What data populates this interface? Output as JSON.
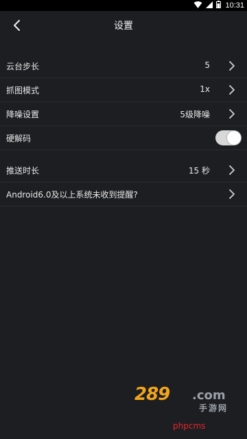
{
  "status_bar": {
    "time": "10:31",
    "icons": [
      "wifi-icon",
      "signal-icon",
      "battery-icon"
    ]
  },
  "header": {
    "title": "设置",
    "back_icon": "chevron-left-icon"
  },
  "settings": {
    "group1": [
      {
        "label": "云台步长",
        "value": "5",
        "type": "chevron"
      },
      {
        "label": "抓图模式",
        "value": "1x",
        "type": "chevron"
      },
      {
        "label": "降噪设置",
        "value": "5级降噪",
        "type": "chevron"
      },
      {
        "label": "硬解码",
        "value": "",
        "type": "toggle",
        "toggle_on": true
      }
    ],
    "group2": [
      {
        "label": "推送时长",
        "value": "15 秒",
        "type": "chevron"
      },
      {
        "label": "Android6.0及以上系统未收到提醒?",
        "value": "",
        "type": "chevron"
      }
    ]
  },
  "watermark": {
    "logo_text": "289",
    "logo_domain": ".com",
    "logo_cn": "手游网",
    "text": "phpcms"
  },
  "colors": {
    "background": "#1d1e22",
    "divider": "#2b2c31",
    "text": "#e8e8e8",
    "toggle_on": "#d8d8d8",
    "watermark_red": "#e3262b",
    "logo_orange": "#f2a51c"
  }
}
